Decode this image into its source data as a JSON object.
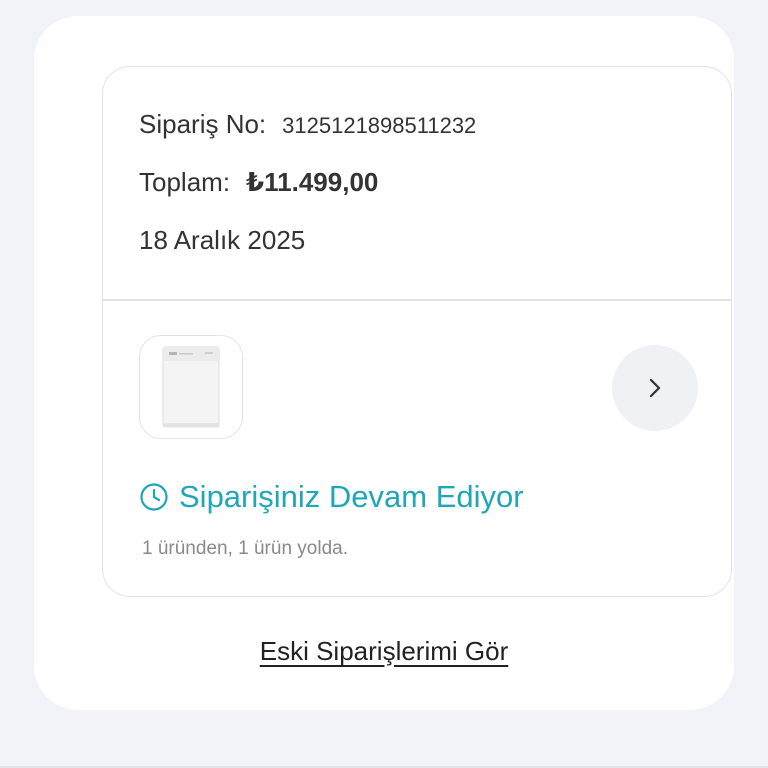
{
  "order": {
    "number_label": "Sipariş No:",
    "number_value": "3125121898511232",
    "total_label": "Toplam:",
    "total_value": "₺11.499,00",
    "date": "18 Aralık 2025"
  },
  "product": {
    "image_icon": "dishwasher-icon",
    "next_icon": "chevron-right-icon"
  },
  "status": {
    "icon": "clock-icon",
    "title": "Siparişiniz Devam Ediyor",
    "subtitle": "1 üründen, 1 ürün yolda.",
    "color": "#1fa7b8"
  },
  "footer": {
    "old_orders_link": "Eski Siparişlerimi Gör"
  }
}
